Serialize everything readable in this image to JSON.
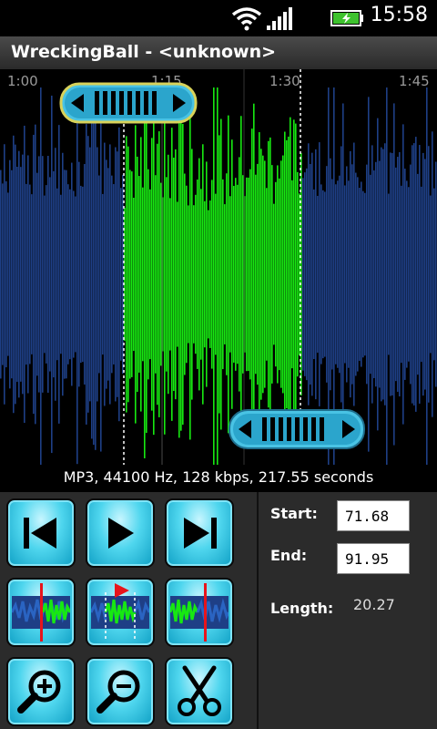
{
  "status_bar": {
    "time": "15:58",
    "icons": [
      "wifi-icon",
      "signal-icon",
      "battery-charging-icon"
    ]
  },
  "app": {
    "title": "WreckingBall - <unknown>"
  },
  "waveform": {
    "time_labels": [
      "1:00",
      "1:15",
      "1:30",
      "1:45"
    ],
    "colors": {
      "background": "#000000",
      "unselected": "#1e3f86",
      "selected": "#17e812",
      "marker": "#ffffff",
      "handle": "#48c3e6"
    }
  },
  "file_info": "MP3, 44100 Hz, 128 kbps, 217.55 seconds",
  "controls": {
    "buttons": [
      "jump-start-icon",
      "play-icon",
      "jump-end-icon",
      "mark-start-icon",
      "play-selection-icon",
      "mark-end-icon",
      "zoom-in-icon",
      "zoom-out-icon",
      "scissors-icon"
    ]
  },
  "selection": {
    "start_label": "Start:",
    "start_value": "71.68",
    "end_label": "End:",
    "end_value": "91.95",
    "length_label": "Length:",
    "length_value": "20.27"
  }
}
